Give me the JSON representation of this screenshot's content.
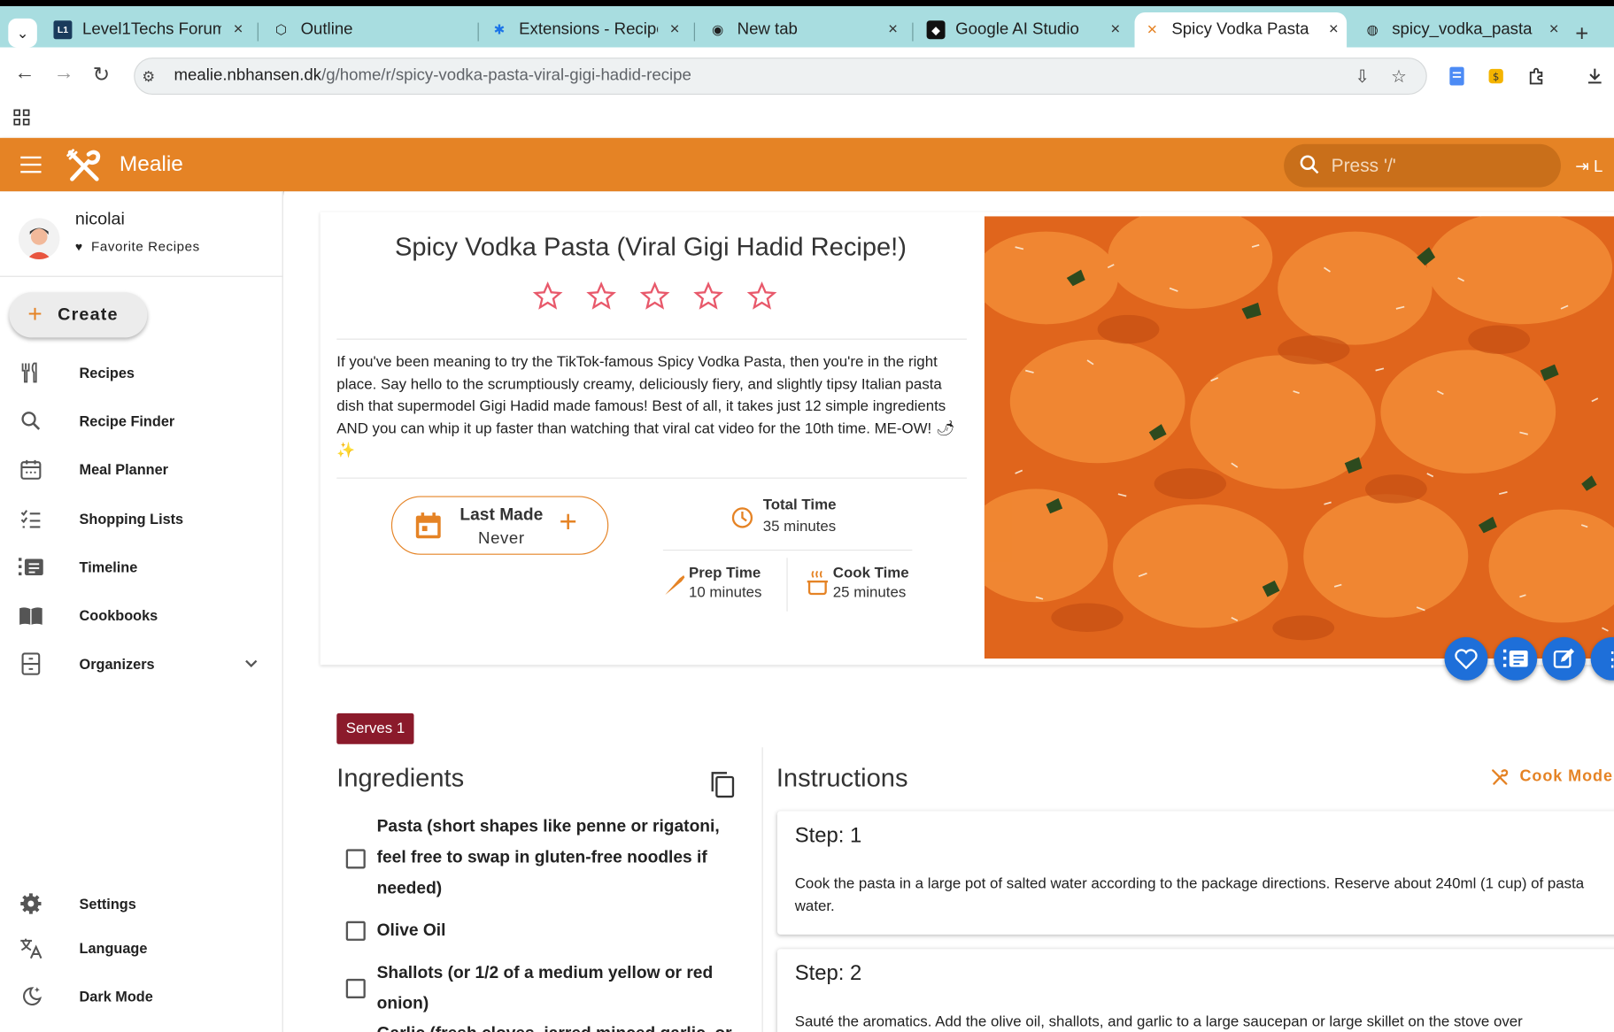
{
  "browser": {
    "tabs": [
      {
        "label": "Level1Techs Forum",
        "icon": "level1-icon"
      },
      {
        "label": "Outline",
        "icon": "outline-icon"
      },
      {
        "label": "Extensions - Recipe",
        "icon": "puzzle-icon"
      },
      {
        "label": "New tab",
        "icon": "chrome-icon"
      },
      {
        "label": "Google AI Studio",
        "icon": "ai-studio-icon"
      },
      {
        "label": "Spicy Vodka Pasta",
        "icon": "mealie-icon",
        "active": true
      },
      {
        "label": "spicy_vodka_pasta",
        "icon": "globe-icon"
      }
    ],
    "url_host": "mealie.nbhansen.dk",
    "url_path": "/g/home/r/spicy-vodka-pasta-viral-gigi-hadid-recipe"
  },
  "app": {
    "title": "Mealie",
    "search_placeholder": "Press '/'",
    "logout_label": "L",
    "accent_color": "#e58325",
    "fab_color": "#1e6fd9"
  },
  "sidebar": {
    "user": "nicolai",
    "favorites_label": "Favorite Recipes",
    "create_label": "Create",
    "items": [
      {
        "label": "Recipes",
        "icon": "fork-knife-icon"
      },
      {
        "label": "Recipe Finder",
        "icon": "search-icon"
      },
      {
        "label": "Meal Planner",
        "icon": "calendar-icon"
      },
      {
        "label": "Shopping Lists",
        "icon": "checklist-icon"
      },
      {
        "label": "Timeline",
        "icon": "timeline-icon"
      },
      {
        "label": "Cookbooks",
        "icon": "book-icon"
      },
      {
        "label": "Organizers",
        "icon": "cabinet-icon"
      }
    ],
    "bottom_items": [
      {
        "label": "Settings",
        "icon": "gear-icon"
      },
      {
        "label": "Language",
        "icon": "translate-icon"
      },
      {
        "label": "Dark Mode",
        "icon": "moon-icon"
      }
    ]
  },
  "recipe": {
    "title": "Spicy Vodka Pasta (Viral Gigi Hadid Recipe!)",
    "rating": 0,
    "rating_max": 5,
    "description": "If you've been meaning to try the TikTok-famous Spicy Vodka Pasta, then you're in the right place. Say hello to the scrumptiously creamy, deliciously fiery, and slightly tipsy Italian pasta dish that supermodel Gigi Hadid made famous! Best of all, it takes just 12 simple ingredients AND you can whip it up faster than watching that viral cat video for the 10th time. ME-OW! 🌶✨",
    "last_made_label": "Last Made",
    "last_made_value": "Never",
    "total_time_label": "Total Time",
    "total_time_value": "35 minutes",
    "prep_time_label": "Prep Time",
    "prep_time_value": "10 minutes",
    "cook_time_label": "Cook Time",
    "cook_time_value": "25 minutes",
    "serves_label": "Serves 1",
    "ingredients_title": "Ingredients",
    "ingredients": [
      "Pasta (short shapes like penne or rigatoni, feel free to swap in gluten-free noodles if needed)",
      "Olive Oil",
      "Shallots (or 1/2 of a medium yellow or red onion)",
      "Garlic (fresh cloves, jarred minced garlic, or"
    ],
    "instructions_title": "Instructions",
    "cook_mode_label": "Cook Mode",
    "steps": [
      {
        "title": "Step: 1",
        "text": "Cook the pasta in a large pot of salted water according to the package directions. Reserve about 240ml (1 cup) of pasta water."
      },
      {
        "title": "Step: 2",
        "text": "Sauté the aromatics. Add the olive oil, shallots, and garlic to a large saucepan or large skillet on the stove over"
      }
    ]
  }
}
